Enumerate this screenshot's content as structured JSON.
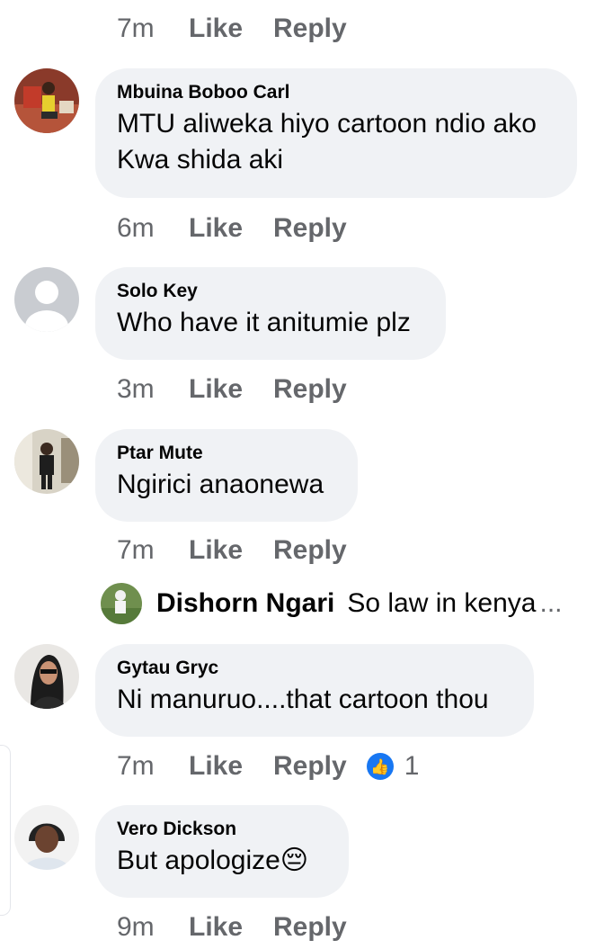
{
  "comments": [
    {
      "author": "Mbuina Boboo Carl",
      "text": "MTU aliweka hiyo cartoon ndio ako Kwa shida aki",
      "line1": "MTU aliweka hiyo cartoon ndio ako",
      "line2": "Kwa shida aki",
      "time": "6m",
      "like": "Like",
      "reply": "Reply"
    },
    {
      "author": "Solo Key",
      "text": "Who have it anitumie plz",
      "time": "3m",
      "like": "Like",
      "reply": "Reply"
    },
    {
      "author": "Ptar Mute",
      "text": "Ngirici anaonewa",
      "time": "7m",
      "like": "Like",
      "reply": "Reply"
    },
    {
      "author": "Gytau  Gryc",
      "text": "Ni manuruo....that cartoon thou",
      "time": "7m",
      "like": "Like",
      "reply": "Reply",
      "reaction_icon": "like-thumb-icon",
      "reaction_count": "1"
    },
    {
      "author": "Vero Dickson",
      "text": "But apologize😔",
      "time": "9m",
      "like": "Like",
      "reply": "Reply"
    }
  ],
  "top_actions": {
    "time": "7m",
    "like": "Like",
    "reply": "Reply"
  },
  "reply_preview": {
    "name": "Dishorn Ngari",
    "text": "So law in kenya",
    "more": "..."
  },
  "colors": {
    "bubble": "#f0f2f5",
    "meta": "#65676b",
    "like_blue": "#1877f2"
  }
}
